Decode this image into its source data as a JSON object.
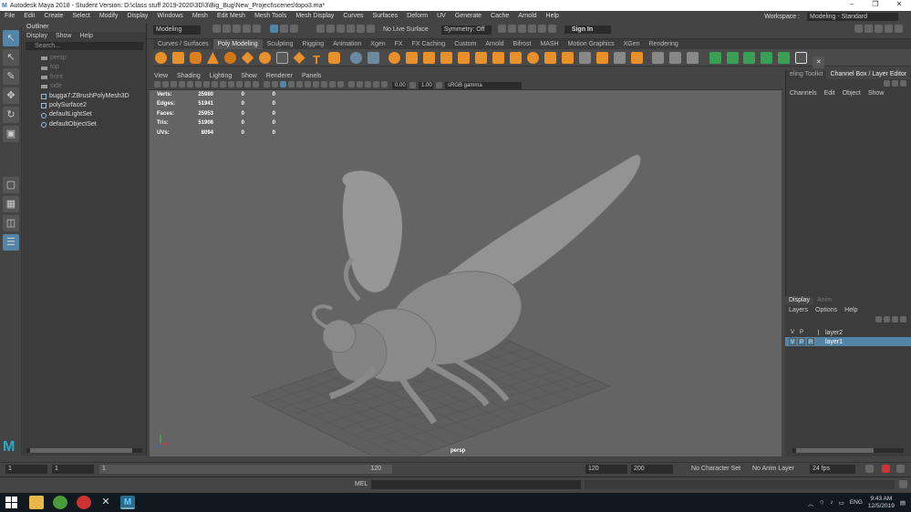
{
  "title": "Autodesk Maya 2018 - Student Version: D:\\class stuff 2019-2020\\3D\\3\\Big_Bug\\New_Project\\scenes\\topo3.ma*",
  "menus": [
    "File",
    "Edit",
    "Create",
    "Select",
    "Modify",
    "Display",
    "Windows",
    "Mesh",
    "Edit Mesh",
    "Mesh Tools",
    "Mesh Display",
    "Curves",
    "Surfaces",
    "Deform",
    "UV",
    "Generate",
    "Cache",
    "Arnold",
    "Help"
  ],
  "workspace": {
    "label": "Workspace :",
    "value": "Modeling - Standard"
  },
  "statusline": {
    "mode": "Modeling",
    "live_surface": "No Live Surface",
    "symmetry": "Symmetry: Off",
    "sign_in": "Sign In"
  },
  "shelf_tabs": [
    "Curves / Surfaces",
    "Poly Modeling",
    "Sculpting",
    "Rigging",
    "Animation",
    "Xgen",
    "FX",
    "FX Caching",
    "Custom",
    "Arnold",
    "Bifrost",
    "MASH",
    "Motion Graphics",
    "XGen",
    "Rendering"
  ],
  "shelf_active": "Poly Modeling",
  "outliner": {
    "title": "Outliner",
    "menu": [
      "Display",
      "Show",
      "Help"
    ],
    "search_placeholder": "Search...",
    "items": [
      {
        "label": "persp",
        "type": "camera",
        "dim": true
      },
      {
        "label": "top",
        "type": "camera",
        "dim": true
      },
      {
        "label": "front",
        "type": "camera",
        "dim": true
      },
      {
        "label": "side",
        "type": "camera",
        "dim": true
      },
      {
        "label": "bugga7:ZBrushPolyMesh3D",
        "type": "mesh",
        "dim": false
      },
      {
        "label": "polySurface2",
        "type": "mesh",
        "dim": false
      },
      {
        "label": "defaultLightSet",
        "type": "set",
        "dim": false
      },
      {
        "label": "defaultObjectSet",
        "type": "set",
        "dim": false
      }
    ]
  },
  "viewport": {
    "menu": [
      "View",
      "Shading",
      "Lighting",
      "Show",
      "Renderer",
      "Panels"
    ],
    "field1": "0.00",
    "field2": "1.00",
    "color_space": "sRGB gamma",
    "camera": "persp",
    "hud": [
      {
        "k": "Verts:",
        "v": "25980",
        "a": "0",
        "b": "0"
      },
      {
        "k": "Edges:",
        "v": "51941",
        "a": "0",
        "b": "0"
      },
      {
        "k": "Faces:",
        "v": "25953",
        "a": "0",
        "b": "0"
      },
      {
        "k": "Tris:",
        "v": "51906",
        "a": "0",
        "b": "0"
      },
      {
        "k": "UVs:",
        "v": "8094",
        "a": "0",
        "b": "0"
      }
    ]
  },
  "right_panel": {
    "tabs": [
      "eling Toolkit",
      "Channel Box / Layer Editor"
    ],
    "menu": [
      "Channels",
      "Edit",
      "Object",
      "Show"
    ],
    "layer_tabs": [
      "Display",
      "Anim"
    ],
    "layer_menu": [
      "Layers",
      "Options",
      "Help"
    ],
    "layers": [
      {
        "v": "V",
        "p": "P",
        "r": "",
        "name": "layer2",
        "selected": false
      },
      {
        "v": "V",
        "p": "P",
        "r": "R",
        "name": "layer1",
        "selected": true
      }
    ]
  },
  "timeline": {
    "start": "1",
    "start2": "1",
    "slider_start": "1",
    "slider_end": "120",
    "end": "120",
    "end2": "200",
    "char_set": "No Character Set",
    "anim_layer": "No Anim Layer",
    "fps": "24 fps"
  },
  "mel": {
    "label": "MEL"
  },
  "taskbar": {
    "lang": "ENG",
    "time": "9:43 AM",
    "date": "12/5/2019"
  }
}
